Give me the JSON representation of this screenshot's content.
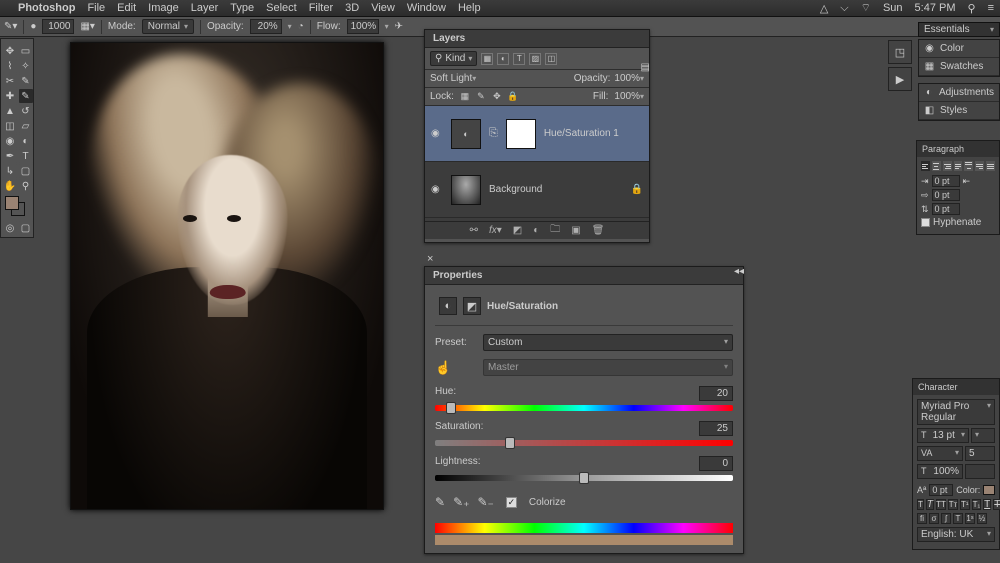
{
  "menubar": {
    "app": "Photoshop",
    "items": [
      "File",
      "Edit",
      "Image",
      "Layer",
      "Type",
      "Select",
      "Filter",
      "3D",
      "View",
      "Window",
      "Help"
    ],
    "status": {
      "day": "Sun",
      "time": "5:47 PM"
    }
  },
  "options": {
    "brush_size": "1000",
    "mode_label": "Mode:",
    "mode": "Normal",
    "opacity_label": "Opacity:",
    "opacity": "20%",
    "flow_label": "Flow:",
    "flow": "100%"
  },
  "dock": {
    "essentials": "Essentials",
    "panels": [
      "Color",
      "Swatches",
      "Adjustments",
      "Styles"
    ]
  },
  "paragraph": {
    "title": "Paragraph",
    "indent_left": "0 pt",
    "indent_right": "0 pt",
    "space_before": "0 pt",
    "hyphenate": "Hyphenate"
  },
  "character": {
    "title": "Character",
    "font": "Myriad Pro Regular",
    "style": "Re",
    "size": "13 pt",
    "tracking": "5",
    "vscale": "100%",
    "color_label": "Color:",
    "lang_label": "English: UK"
  },
  "layers": {
    "title": "Layers",
    "kind": "Kind",
    "blend": "Soft Light",
    "opacity_label": "Opacity:",
    "opacity": "100%",
    "lock_label": "Lock:",
    "fill_label": "Fill:",
    "fill": "100%",
    "items": [
      {
        "name": "Hue/Saturation 1",
        "locked": false
      },
      {
        "name": "Background",
        "locked": true
      }
    ]
  },
  "properties": {
    "title": "Properties",
    "type": "Hue/Saturation",
    "preset_label": "Preset:",
    "preset": "Custom",
    "channel": "Master",
    "hue_label": "Hue:",
    "hue": "20",
    "sat_label": "Saturation:",
    "sat": "25",
    "light_label": "Lightness:",
    "light": "0",
    "colorize": "Colorize"
  }
}
